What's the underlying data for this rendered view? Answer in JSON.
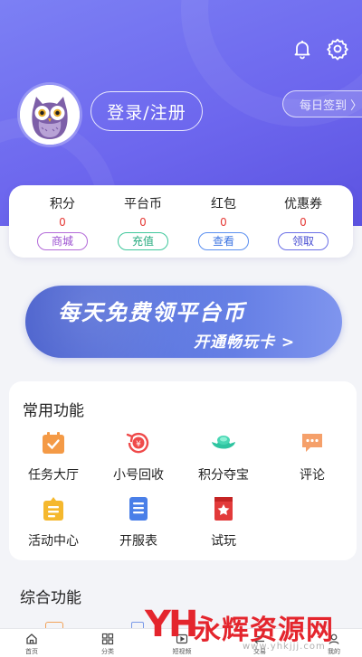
{
  "header": {
    "login_label": "登录/注册",
    "signin_label": "每日签到 〉",
    "icons": {
      "bell": "bell-icon",
      "settings": "gear-icon",
      "avatar": "owl-avatar"
    }
  },
  "stats": [
    {
      "label": "积分",
      "value": "0",
      "action": "商城",
      "color": "#9b4fd0"
    },
    {
      "label": "平台币",
      "value": "0",
      "action": "充值",
      "color": "#22a97c"
    },
    {
      "label": "红包",
      "value": "0",
      "action": "查看",
      "color": "#3c74e2"
    },
    {
      "label": "优惠券",
      "value": "0",
      "action": "领取",
      "color": "#474cd2"
    }
  ],
  "banner": {
    "line1": "每天免费领平台币",
    "line2": "开通畅玩卡 >"
  },
  "common": {
    "title": "常用功能",
    "items": [
      {
        "label": "任务大厅",
        "icon": "task-calendar-icon"
      },
      {
        "label": "小号回收",
        "icon": "recycle-coin-icon"
      },
      {
        "label": "积分夺宝",
        "icon": "gold-ingot-icon"
      },
      {
        "label": "评论",
        "icon": "comment-bubble-icon"
      },
      {
        "label": "活动中心",
        "icon": "activity-board-icon"
      },
      {
        "label": "开服表",
        "icon": "server-list-icon"
      },
      {
        "label": "试玩",
        "icon": "trial-bookmark-icon"
      }
    ]
  },
  "general": {
    "title": "综合功能"
  },
  "tabs": [
    {
      "label": "首页",
      "icon": "home-icon"
    },
    {
      "label": "分类",
      "icon": "grid-icon"
    },
    {
      "label": "短视频",
      "icon": "video-icon"
    },
    {
      "label": "交易",
      "icon": "trade-icon"
    },
    {
      "label": "我的",
      "icon": "profile-icon"
    }
  ],
  "watermark": {
    "logo": "YH",
    "name": "永辉资源网",
    "url": "www.yhkjjj.com"
  },
  "colors": {
    "hero": "#6d67ee",
    "accent_red": "#e53935",
    "banner": "#4a63d6"
  }
}
